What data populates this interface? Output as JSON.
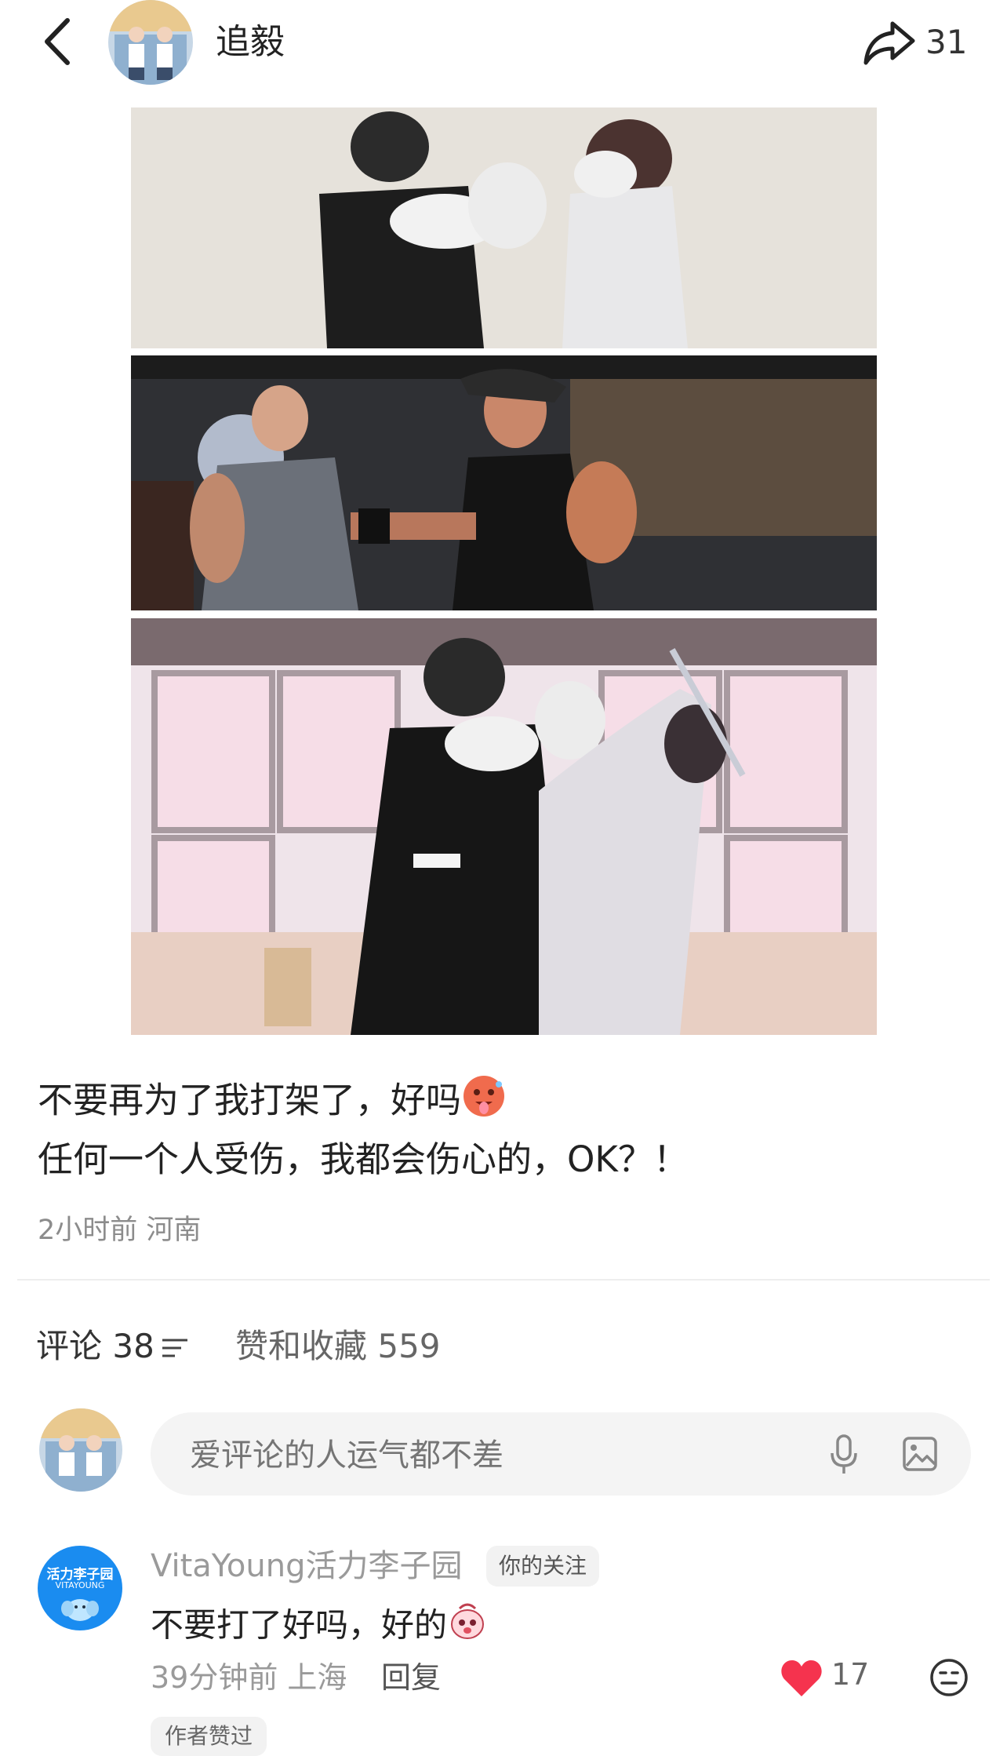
{
  "header": {
    "author_name": "追毅",
    "share_count": "31"
  },
  "post": {
    "line1": "不要再为了我打架了，好吗",
    "line1_emoji": "hot-face-emoji",
    "line2": "任何一个人受伤，我都会伤心的，OK？！",
    "meta": "2小时前 河南"
  },
  "tabs": {
    "comments": "评论 38",
    "likes": "赞和收藏 559"
  },
  "input": {
    "placeholder": "爱评论的人运气都不差"
  },
  "comment": {
    "avatar_text_1": "活力李子园",
    "avatar_text_2": "VITAYOUNG",
    "user": "VitaYoung活力李子园",
    "badge": "你的关注",
    "text": "不要打了好吗，好的",
    "text_emoji": "cute-face-emoji",
    "time_location": "39分钟前 上海",
    "reply": "回复",
    "like_count": "17",
    "author_liked": "作者赞过"
  },
  "colors": {
    "heart": "#f5334e",
    "comment_avatar_bg": "#1a8cf0"
  }
}
